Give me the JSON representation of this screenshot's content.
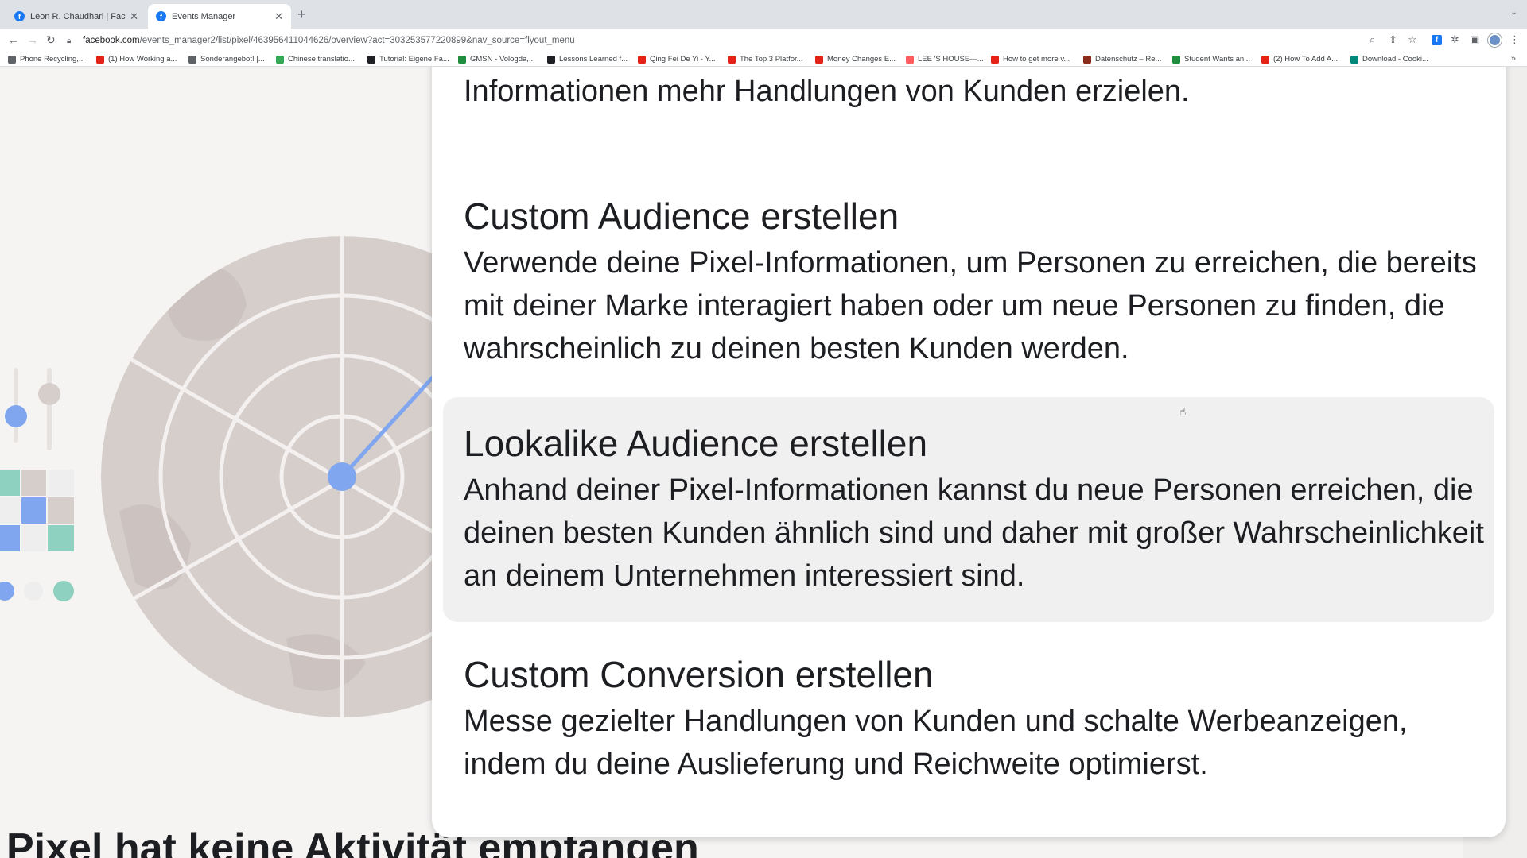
{
  "browser": {
    "tabs": [
      {
        "title": "Leon R. Chaudhari | Facebook",
        "favicon": "facebook-icon",
        "active": false
      },
      {
        "title": "Events Manager",
        "favicon": "facebook-icon",
        "active": true
      }
    ],
    "url_host": "facebook.com",
    "url_path": "/events_manager2/list/pixel/463956411044626/overview?act=303253577220899&nav_source=flyout_menu",
    "bookmarks": [
      {
        "label": "Phone Recycling,...",
        "color": "#5f6368"
      },
      {
        "label": "(1) How Working a...",
        "color": "#e62117"
      },
      {
        "label": "Sonderangebot! |...",
        "color": "#5f6368"
      },
      {
        "label": "Chinese translatio...",
        "color": "#34a853"
      },
      {
        "label": "Tutorial: Eigene Fa...",
        "color": "#202124"
      },
      {
        "label": "GMSN - Vologda,...",
        "color": "#1e8e3e"
      },
      {
        "label": "Lessons Learned f...",
        "color": "#202124"
      },
      {
        "label": "Qing Fei De Yi - Y...",
        "color": "#e62117"
      },
      {
        "label": "The Top 3 Platfor...",
        "color": "#e62117"
      },
      {
        "label": "Money Changes E...",
        "color": "#e62117"
      },
      {
        "label": "LEE 'S HOUSE—...",
        "color": "#ff5a5f"
      },
      {
        "label": "How to get more v...",
        "color": "#e62117"
      },
      {
        "label": "Datenschutz – Re...",
        "color": "#8b2b1b"
      },
      {
        "label": "Student Wants an...",
        "color": "#1e8e3e"
      },
      {
        "label": "(2) How To Add A...",
        "color": "#e62117"
      },
      {
        "label": "Download - Cooki...",
        "color": "#00897b"
      }
    ]
  },
  "dialog": {
    "cut_text": "Informationen mehr Handlungen von Kunden erzielen.",
    "options": [
      {
        "title": "Custom Audience erstellen",
        "description": "Verwende deine Pixel-Informationen, um Personen zu erreichen, die bereits mit deiner Marke interagiert haben oder um neue Personen zu finden, die wahrscheinlich zu deinen besten Kunden werden."
      },
      {
        "title": "Lookalike Audience erstellen",
        "description": "Anhand deiner Pixel-Informationen kannst du neue Personen erreichen, die deinen besten Kunden ähnlich sind und daher mit großer Wahrscheinlichkeit an deinem Unternehmen interessiert sind."
      },
      {
        "title": "Custom Conversion erstellen",
        "description": "Messe gezielter Handlungen von Kunden und schalte Werbeanzeigen, indem du deine Auslieferung und Reichweite optimierst."
      }
    ]
  },
  "page": {
    "heading": "Pixel hat keine Aktivität empfangen"
  },
  "colors": {
    "accent_blue": "#7fa6ef",
    "teal": "#8ed1c0",
    "radar": "#d4ccc9"
  }
}
